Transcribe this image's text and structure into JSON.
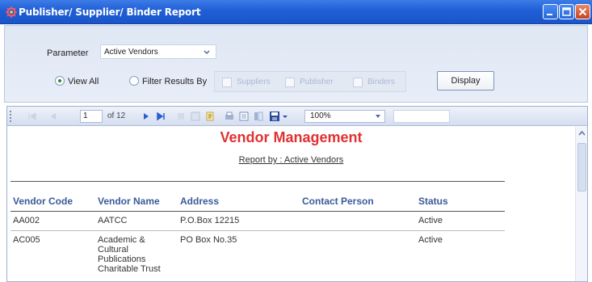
{
  "window": {
    "title": "Publisher/ Supplier/ Binder Report"
  },
  "params": {
    "parameter_label": "Parameter",
    "parameter_value": "Active Vendors",
    "view_all_label": "View All",
    "filter_label": "Filter Results By",
    "suppliers_label": "Suppliers",
    "publisher_label": "Publisher",
    "binders_label": "Binders",
    "display_label": "Display"
  },
  "toolbar": {
    "page_current": "1",
    "page_of": "of 12",
    "zoom": "100%"
  },
  "report": {
    "title": "Vendor Management",
    "subtitle": "Report by : Active Vendors",
    "columns": [
      "Vendor Code",
      "Vendor Name",
      "Address",
      "Contact Person",
      "Status"
    ],
    "rows": [
      {
        "code": "AA002",
        "name": "AATCC",
        "address": "P.O.Box 12215",
        "contact": "",
        "status": "Active"
      },
      {
        "code": "AC005",
        "name": "Academic & Cultural Publications Charitable Trust",
        "address": "PO Box No.35",
        "contact": "",
        "status": "Active"
      }
    ]
  },
  "colors": {
    "titlebar": "#1f5fd6",
    "report_title": "#e03131",
    "column_header": "#3a5a9a"
  }
}
